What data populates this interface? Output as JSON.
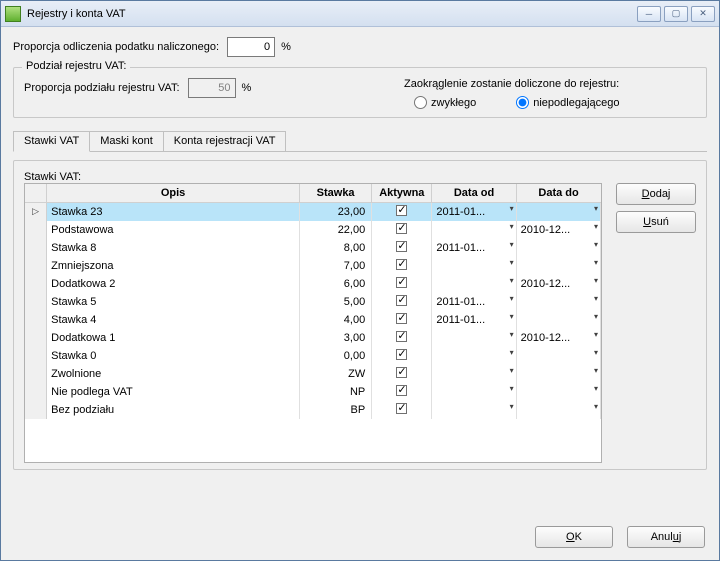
{
  "window": {
    "title": "Rejestry i konta VAT"
  },
  "top": {
    "prop_label": "Proporcja odliczenia podatku naliczonego:",
    "prop_value": "0",
    "pct": "%"
  },
  "split_group": {
    "legend": "Podział rejestru VAT:",
    "prop_label": "Proporcja podziału rejestru VAT:",
    "prop_value": "50",
    "pct": "%",
    "round_label": "Zaokrąglenie zostanie doliczone do rejestru:",
    "radio1": "zwykłego",
    "radio2": "niepodlegającego"
  },
  "tabs": {
    "t1": "Stawki VAT",
    "t2": "Maski kont",
    "t3": "Konta rejestracji VAT"
  },
  "grid": {
    "legend": "Stawki VAT:",
    "headers": {
      "opis": "Opis",
      "stawka": "Stawka",
      "aktywna": "Aktywna",
      "data_od": "Data od",
      "data_do": "Data do"
    },
    "rows": [
      {
        "opis": "Stawka 23",
        "stawka": "23,00",
        "akt": true,
        "od": "2011-01...",
        "do": "",
        "sel": true
      },
      {
        "opis": "Podstawowa",
        "stawka": "22,00",
        "akt": true,
        "od": "",
        "do": "2010-12..."
      },
      {
        "opis": "Stawka 8",
        "stawka": "8,00",
        "akt": true,
        "od": "2011-01...",
        "do": ""
      },
      {
        "opis": "Zmniejszona",
        "stawka": "7,00",
        "akt": true,
        "od": "",
        "do": ""
      },
      {
        "opis": "Dodatkowa 2",
        "stawka": "6,00",
        "akt": true,
        "od": "",
        "do": "2010-12..."
      },
      {
        "opis": "Stawka 5",
        "stawka": "5,00",
        "akt": true,
        "od": "2011-01...",
        "do": ""
      },
      {
        "opis": "Stawka 4",
        "stawka": "4,00",
        "akt": true,
        "od": "2011-01...",
        "do": ""
      },
      {
        "opis": "Dodatkowa 1",
        "stawka": "3,00",
        "akt": true,
        "od": "",
        "do": "2010-12..."
      },
      {
        "opis": "Stawka 0",
        "stawka": "0,00",
        "akt": true,
        "od": "",
        "do": ""
      },
      {
        "opis": "Zwolnione",
        "stawka": "ZW",
        "akt": true,
        "od": "",
        "do": ""
      },
      {
        "opis": "Nie podlega VAT",
        "stawka": "NP",
        "akt": true,
        "od": "",
        "do": ""
      },
      {
        "opis": "Bez podziału",
        "stawka": "BP",
        "akt": true,
        "od": "",
        "do": ""
      }
    ]
  },
  "buttons": {
    "dodaj": "Dodaj",
    "usun": "Usuń",
    "ok": "OK",
    "anuluj": "Anuluj"
  }
}
